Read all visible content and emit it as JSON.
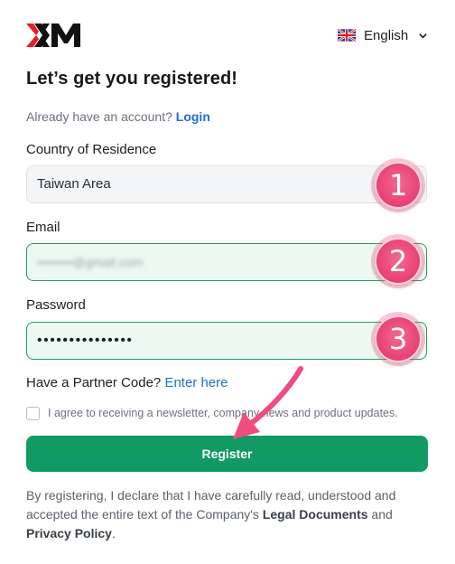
{
  "header": {
    "logo_text": "XM",
    "language": {
      "label": "English",
      "flag_icon": "uk-flag-icon"
    }
  },
  "page_title": "Let’s get you registered!",
  "login_prompt": {
    "text": "Already have an account?",
    "link": "Login"
  },
  "country": {
    "label": "Country of Residence",
    "value": "Taiwan Area"
  },
  "email": {
    "label": "Email",
    "value": "••••••••@gmail.com"
  },
  "password": {
    "label": "Password",
    "value": "•••••••••••••••"
  },
  "partner": {
    "text": "Have a Partner Code?",
    "link": "Enter here"
  },
  "newsletter": {
    "text": "I agree to receiving a newsletter, company news and product updates."
  },
  "register_button": "Register",
  "disclaimer": {
    "text_before": "By registering, I declare that I have carefully read, understood and accepted the entire text of the Company's",
    "legal_link": "Legal Documents",
    "middle": "and",
    "privacy_link": "Privacy Policy",
    "end": "."
  },
  "annotations": [
    "1",
    "2",
    "3"
  ],
  "colors": {
    "brand_red": "#e31e24",
    "primary_green": "#119a64",
    "link_blue": "#1e6fd0",
    "badge_pink": "#e83f74"
  }
}
